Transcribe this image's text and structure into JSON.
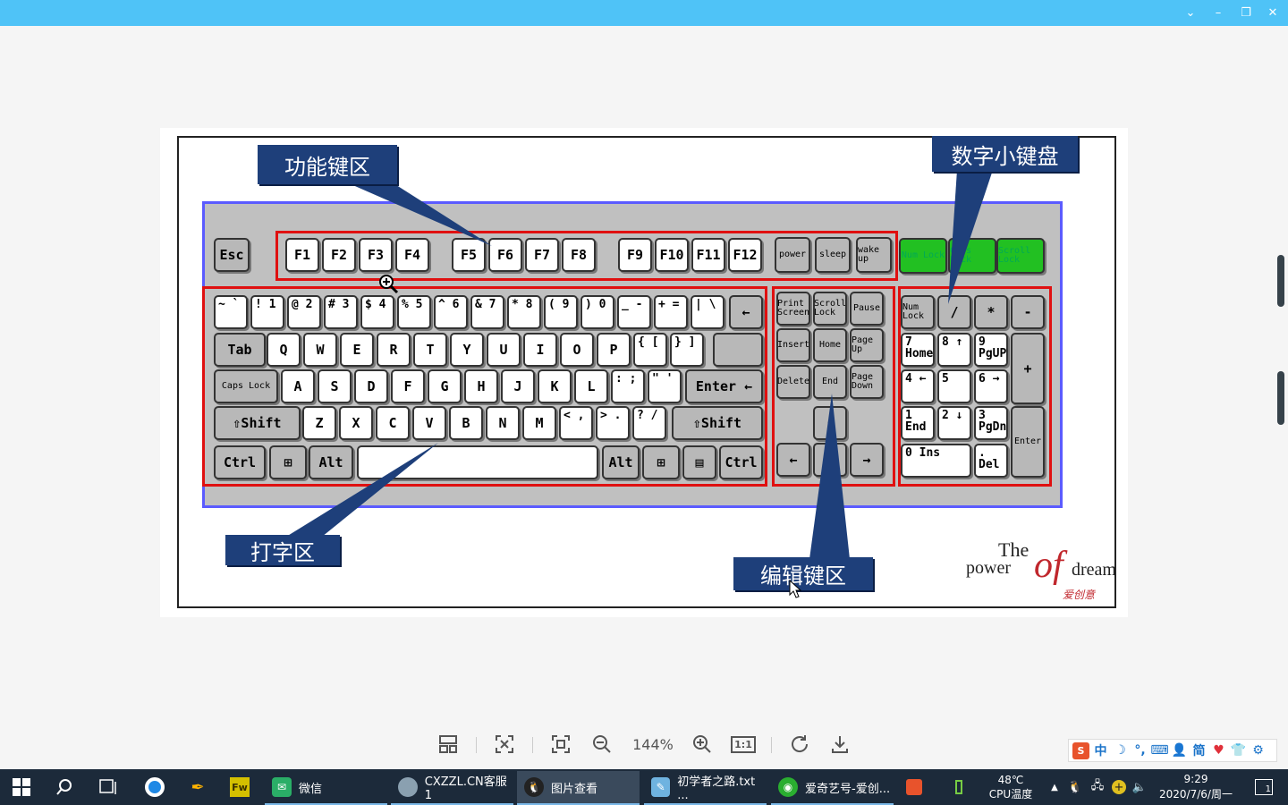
{
  "window": {
    "controls": {
      "collapse": "⌄",
      "minimize": "–",
      "restore": "❐",
      "close": "✕"
    }
  },
  "image": {
    "keys": {
      "esc": "Esc",
      "fn": [
        "F1",
        "F2",
        "F3",
        "F4",
        "F5",
        "F6",
        "F7",
        "F8",
        "F9",
        "F10",
        "F11",
        "F12"
      ],
      "power": [
        "power",
        "sleep",
        "wake up"
      ],
      "locks": [
        "Num Lock",
        "Caps Lock",
        "Scroll Lock"
      ],
      "row1": [
        "~ `",
        "! 1",
        "@ 2",
        "# 3",
        "$ 4",
        "% 5",
        "^ 6",
        "& 7",
        "* 8",
        "( 9",
        ") 0",
        "_ -",
        "+ =",
        "| \\",
        "←"
      ],
      "row2": [
        "Tab",
        "Q",
        "W",
        "E",
        "R",
        "T",
        "Y",
        "U",
        "I",
        "O",
        "P",
        "{ [",
        "} ]"
      ],
      "row3": [
        "Caps Lock",
        "A",
        "S",
        "D",
        "F",
        "G",
        "H",
        "J",
        "K",
        "L",
        ": ;",
        "\" '",
        "Enter ←"
      ],
      "row4": [
        "⇧Shift",
        "Z",
        "X",
        "C",
        "V",
        "B",
        "N",
        "M",
        "< ,",
        "> .",
        "? /",
        "⇧Shift"
      ],
      "row5": [
        "Ctrl",
        "⊞",
        "Alt",
        "",
        "Alt",
        "⊞",
        "▤",
        "Ctrl"
      ],
      "edit": [
        "Print Screen",
        "Scroll Lock",
        "Pause",
        "Insert",
        "Home",
        "Page Up",
        "Delete",
        "End",
        "Page Down",
        "↑",
        "←",
        "↓",
        "→"
      ],
      "num": [
        "Num Lock",
        "/",
        "*",
        "-",
        "7 Home",
        "8 ↑",
        "9 PgUP",
        "+",
        "4 ←",
        "5",
        "6 →",
        "1 End",
        "2 ↓",
        "3 PgDn",
        "Enter",
        "0 Ins",
        ". Del"
      ]
    },
    "labels": {
      "function_zone": "功能键区",
      "numpad_zone": "数字小键盘",
      "typing_zone": "打字区",
      "edit_zone": "编辑键区"
    },
    "logo": {
      "the": "The",
      "power": "power",
      "of": "of",
      "dream": "dream",
      "signature": "爱创意"
    }
  },
  "toolbar": {
    "zoom_level": "144%",
    "actual_size": "1:1"
  },
  "ime": {
    "items": [
      "中",
      "简"
    ]
  },
  "taskbar": {
    "tasks": [
      {
        "label": "微信",
        "icon": "wechat-icon"
      },
      {
        "label": "CXZZL.CN客服1",
        "icon": "avatar-icon"
      },
      {
        "label": "图片查看",
        "icon": "qq-icon"
      },
      {
        "label": "初学者之路.txt ...",
        "icon": "notepad-icon"
      },
      {
        "label": "爱奇艺号-爱创...",
        "icon": "iqiyi-icon"
      }
    ],
    "temperature": "48℃",
    "cpu_label": "CPU温度",
    "time": "9:29",
    "date": "2020/7/6/周一",
    "notification_count": "1"
  },
  "colors": {
    "titlebar": "#4fc3f7",
    "label_bg": "#1e3f7a",
    "zone_red": "#e01010",
    "kb_border": "#5b5bff",
    "taskbar": "#1c2a3a"
  }
}
